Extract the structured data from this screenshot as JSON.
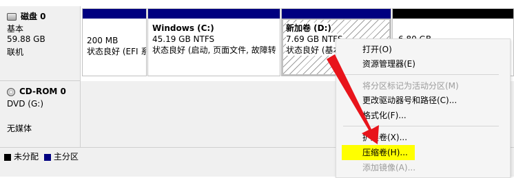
{
  "disks": {
    "disk0": {
      "name": "磁盘 0",
      "type": "基本",
      "size": "59.88 GB",
      "status": "联机",
      "partitions": [
        {
          "size": "200 MB",
          "status": "状态良好 (EFI 系"
        },
        {
          "name": "Windows  (C:)",
          "size": "45.19 GB NTFS",
          "status": "状态良好 (启动, 页面文件, 故障转"
        },
        {
          "name": "新加卷  (D:)",
          "size": "7.69 GB NTFS",
          "status": "状态良好 (基本"
        },
        {
          "size": "6.80 GB"
        }
      ]
    },
    "cdrom": {
      "name": "CD-ROM 0",
      "type": "DVD (G:)",
      "media": "无媒体"
    }
  },
  "legend": {
    "unallocated": "未分配",
    "primary": "主分区"
  },
  "context_menu": {
    "items": [
      {
        "label": "打开(O)",
        "enabled": true
      },
      {
        "label": "资源管理器(E)",
        "enabled": true
      },
      {
        "label": "将分区标记为活动分区(M)",
        "enabled": false
      },
      {
        "label": "更改驱动器号和路径(C)...",
        "enabled": true
      },
      {
        "label": "格式化(F)...",
        "enabled": true
      },
      {
        "label": "扩展卷(X)...",
        "enabled": true
      },
      {
        "label": "压缩卷(H)...",
        "enabled": true,
        "highlighted": true
      },
      {
        "label": "添加镜像(A)...",
        "enabled": false
      }
    ]
  },
  "colors": {
    "primary_partition": "#000080",
    "unallocated": "#000000",
    "highlight": "#ffff00",
    "arrow": "#e8141b"
  }
}
